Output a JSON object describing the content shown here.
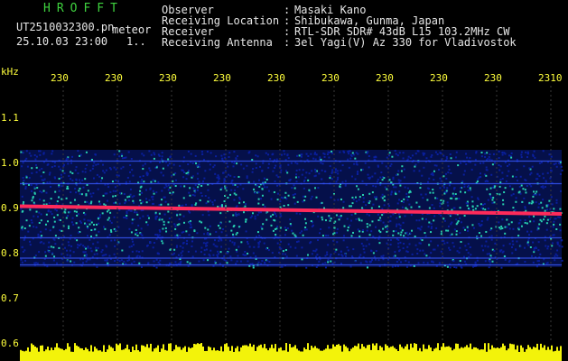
{
  "header": {
    "brand": "HROFFT",
    "file_name": "UT2510032300.pn",
    "mode": "meteor",
    "datetime": "25.10.03 23:00",
    "page_marker": "1..",
    "fields": [
      {
        "label": "Observer",
        "sep": ":",
        "value": "Masaki Kano"
      },
      {
        "label": "Receiving Location",
        "sep": ":",
        "value": "Shibukawa, Gunma, Japan"
      },
      {
        "label": "Receiver",
        "sep": ":",
        "value": "RTL-SDR SDR# 43dB L15 103.2MHz CW"
      },
      {
        "label": "Receiving Antenna",
        "sep": ":",
        "value": "3el Yagi(V) Az 330 for Vladivostok"
      }
    ]
  },
  "spectrogram": {
    "unit_label": "kHz",
    "y_ticks": [
      {
        "label": "1.1",
        "value": 1.1
      },
      {
        "label": "1.0",
        "value": 1.0
      },
      {
        "label": "0.9",
        "value": 0.9
      },
      {
        "label": "0.8",
        "value": 0.8
      },
      {
        "label": "0.7",
        "value": 0.7
      },
      {
        "label": "0.6",
        "value": 0.6
      }
    ],
    "x_ticks": [
      "230",
      "230",
      "230",
      "230",
      "230",
      "230",
      "230",
      "230",
      "230",
      "2310"
    ],
    "signal_line_khz": [
      0.905,
      0.888
    ],
    "noise_band_khz": [
      0.77,
      1.03
    ],
    "horizontal_lines_khz": [
      1.005,
      0.955,
      0.835,
      0.79,
      0.775
    ],
    "colors": {
      "background": "#000000",
      "labels": "#ffff3c",
      "brand": "#3fd23f",
      "signal": "#ff2a5a",
      "noise_low": "#0a1f9e",
      "noise_high": "#27d0b0",
      "level_bar": "#f3f30a",
      "gridline": "#3a5aff"
    }
  }
}
